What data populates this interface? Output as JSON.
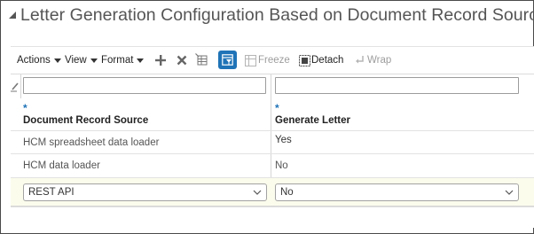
{
  "header": {
    "title": "Letter Generation Configuration Based on Document Record Source"
  },
  "toolbar": {
    "actions_label": "Actions",
    "view_label": "View",
    "format_label": "Format",
    "freeze_label": "Freeze",
    "detach_label": "Detach",
    "wrap_label": "Wrap"
  },
  "table": {
    "required_marker": "*",
    "columns": [
      {
        "label": "Document Record Source"
      },
      {
        "label": "Generate Letter"
      }
    ],
    "filters": [
      "",
      ""
    ],
    "rows": [
      {
        "source": "HCM spreadsheet data loader",
        "generate": "Yes"
      },
      {
        "source": "HCM data loader",
        "generate": "No"
      },
      {
        "source": "REST API",
        "generate": "No"
      }
    ]
  },
  "colors": {
    "accent": "#1f73b7",
    "selected_row": "#fbfcec"
  }
}
